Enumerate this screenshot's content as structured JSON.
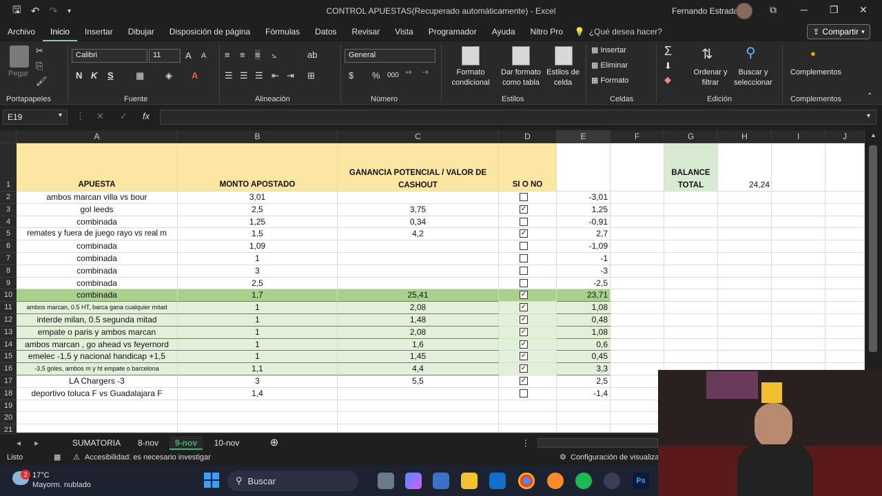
{
  "window": {
    "title": "CONTROL APUESTAS(Recuperado automáticamente)  -  Excel",
    "user": "Fernando Estrada"
  },
  "menu": {
    "tabs": [
      "Archivo",
      "Inicio",
      "Insertar",
      "Dibujar",
      "Disposición de página",
      "Fórmulas",
      "Datos",
      "Revisar",
      "Vista",
      "Programador",
      "Ayuda",
      "Nitro Pro"
    ],
    "active": "Inicio",
    "search_placeholder": "¿Qué desea hacer?",
    "share": "Compartir"
  },
  "ribbon": {
    "paste": "Pegar",
    "font_name": "Calibri",
    "font_size": "11",
    "number_format": "General",
    "bold": "N",
    "italic": "K",
    "underline": "S",
    "cond_format": [
      "Formato",
      "condicional"
    ],
    "table_format": [
      "Dar formato",
      "como tabla"
    ],
    "cell_styles": [
      "Estilos de",
      "celda"
    ],
    "insert": "Insertar",
    "delete": "Eliminar",
    "format": "Formato",
    "sort_filter": [
      "Ordenar y",
      "filtrar"
    ],
    "find_select": [
      "Buscar y",
      "seleccionar"
    ],
    "addins": "Complementos",
    "groups": {
      "clipboard": "Portapapeles",
      "font": "Fuente",
      "alignment": "Alineación",
      "number": "Número",
      "styles": "Estilos",
      "cells": "Celdas",
      "editing": "Edición",
      "addins": "Complementos"
    }
  },
  "formula_bar": {
    "name_box": "E19",
    "fx": "fx",
    "content": ""
  },
  "columns": [
    "A",
    "B",
    "C",
    "D",
    "E",
    "F",
    "G",
    "H",
    "I",
    "J"
  ],
  "row_numbers": [
    "1",
    "2",
    "3",
    "4",
    "5",
    "6",
    "7",
    "8",
    "9",
    "10",
    "11",
    "12",
    "13",
    "14",
    "15",
    "16",
    "17",
    "18",
    "19",
    "20",
    "21"
  ],
  "headers": {
    "a": "APUESTA",
    "b": "MONTO APOSTADO",
    "c1": "GANANCIA POTENCIAL / VALOR DE",
    "c2": "CASHOUT",
    "d": "SI O NO",
    "g1": "BALANCE",
    "g2": "TOTAL",
    "h": "24,24"
  },
  "rows": [
    {
      "a": "ambos marcan villa vs bour",
      "b": "3,01",
      "c": "",
      "d": false,
      "e": "-3,01"
    },
    {
      "a": "gol leeds",
      "b": "2,5",
      "c": "3,75",
      "d": true,
      "e": "1,25"
    },
    {
      "a": "combinada",
      "b": "1,25",
      "c": "0,34",
      "d": false,
      "e": "-0,91"
    },
    {
      "a": "remates y fuera de juego rayo vs real m",
      "b": "1,5",
      "c": "4,2",
      "d": true,
      "e": "2,7"
    },
    {
      "a": "combinada",
      "b": "1,09",
      "c": "",
      "d": false,
      "e": "-1,09"
    },
    {
      "a": "combinada",
      "b": "1",
      "c": "",
      "d": false,
      "e": "-1"
    },
    {
      "a": "combinada",
      "b": "3",
      "c": "",
      "d": false,
      "e": "-3"
    },
    {
      "a": "combinada",
      "b": "2,5",
      "c": "",
      "d": false,
      "e": "-2,5"
    },
    {
      "a": "combinada",
      "b": "1,7",
      "c": "25,41",
      "d": true,
      "e": "23,71"
    },
    {
      "a": "ambos marcan, 0.5 HT, barca gana cualquier mitad",
      "b": "1",
      "c": "2,08",
      "d": true,
      "e": "1,08"
    },
    {
      "a": "interde milan, 0.5 segunda mitad",
      "b": "1",
      "c": "1,48",
      "d": true,
      "e": "0,48"
    },
    {
      "a": "empate o paris y ambos marcan",
      "b": "1",
      "c": "2,08",
      "d": true,
      "e": "1,08"
    },
    {
      "a": "ambos marcan , go ahead vs feyernord",
      "b": "1",
      "c": "1,6",
      "d": true,
      "e": "0,6"
    },
    {
      "a": "emelec -1,5 y nacional handicap +1,5",
      "b": "1",
      "c": "1,45",
      "d": true,
      "e": "0,45"
    },
    {
      "a": "-3,5 goles, ambos m y ht empate o barcelona",
      "b": "1,1",
      "c": "4,4",
      "d": true,
      "e": "3,3"
    },
    {
      "a": "LA Chargers -3",
      "b": "3",
      "c": "5,5",
      "d": true,
      "e": "2,5"
    },
    {
      "a": "deportivo toluca F vs Guadalajara F",
      "b": "1,4",
      "c": "",
      "d": false,
      "e": "-1,4"
    }
  ],
  "sheet_tabs": [
    "SUMATORIA",
    "8-nov",
    "9-nov",
    "10-nov"
  ],
  "active_sheet": "9-nov",
  "status": {
    "ready": "Listo",
    "accessibility": "Accesibilidad: es necesario investigar",
    "view_settings": "Configuración de visualiza"
  },
  "taskbar": {
    "weather_temp": "17°C",
    "weather_desc": "Mayorm. nublado",
    "weather_badge": "2",
    "search": "Buscar"
  }
}
